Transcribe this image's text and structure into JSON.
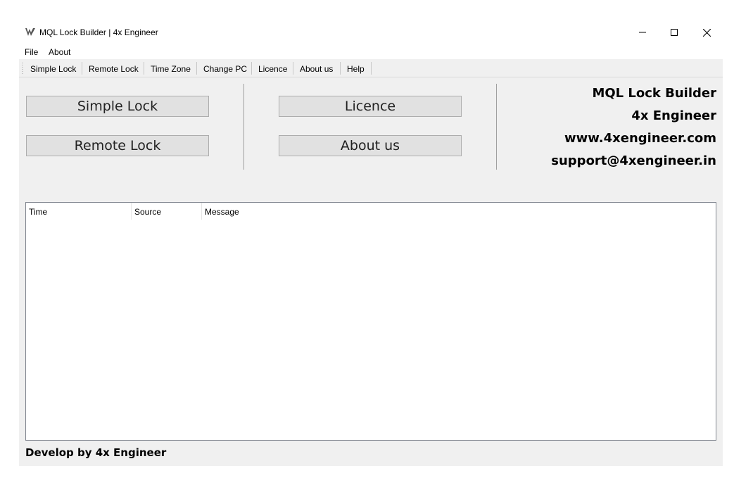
{
  "window": {
    "title": "MQL Lock Builder | 4x Engineer"
  },
  "menubar": {
    "items": [
      "File",
      "About"
    ]
  },
  "toolbar": {
    "items": [
      "Simple Lock",
      "Remote Lock",
      "Time Zone",
      "Change PC",
      "Licence",
      "About us",
      "Help"
    ]
  },
  "buttons": {
    "simple_lock": "Simple Lock",
    "remote_lock": "Remote Lock",
    "licence": "Licence",
    "about_us": "About us"
  },
  "info": {
    "app_name": "MQL Lock Builder",
    "company": "4x Engineer",
    "website": "www.4xengineer.com",
    "email": "support@4xengineer.in"
  },
  "log": {
    "columns": [
      "Time",
      "Source",
      "Message"
    ],
    "rows": []
  },
  "footer": {
    "text": "Develop by 4x Engineer"
  }
}
